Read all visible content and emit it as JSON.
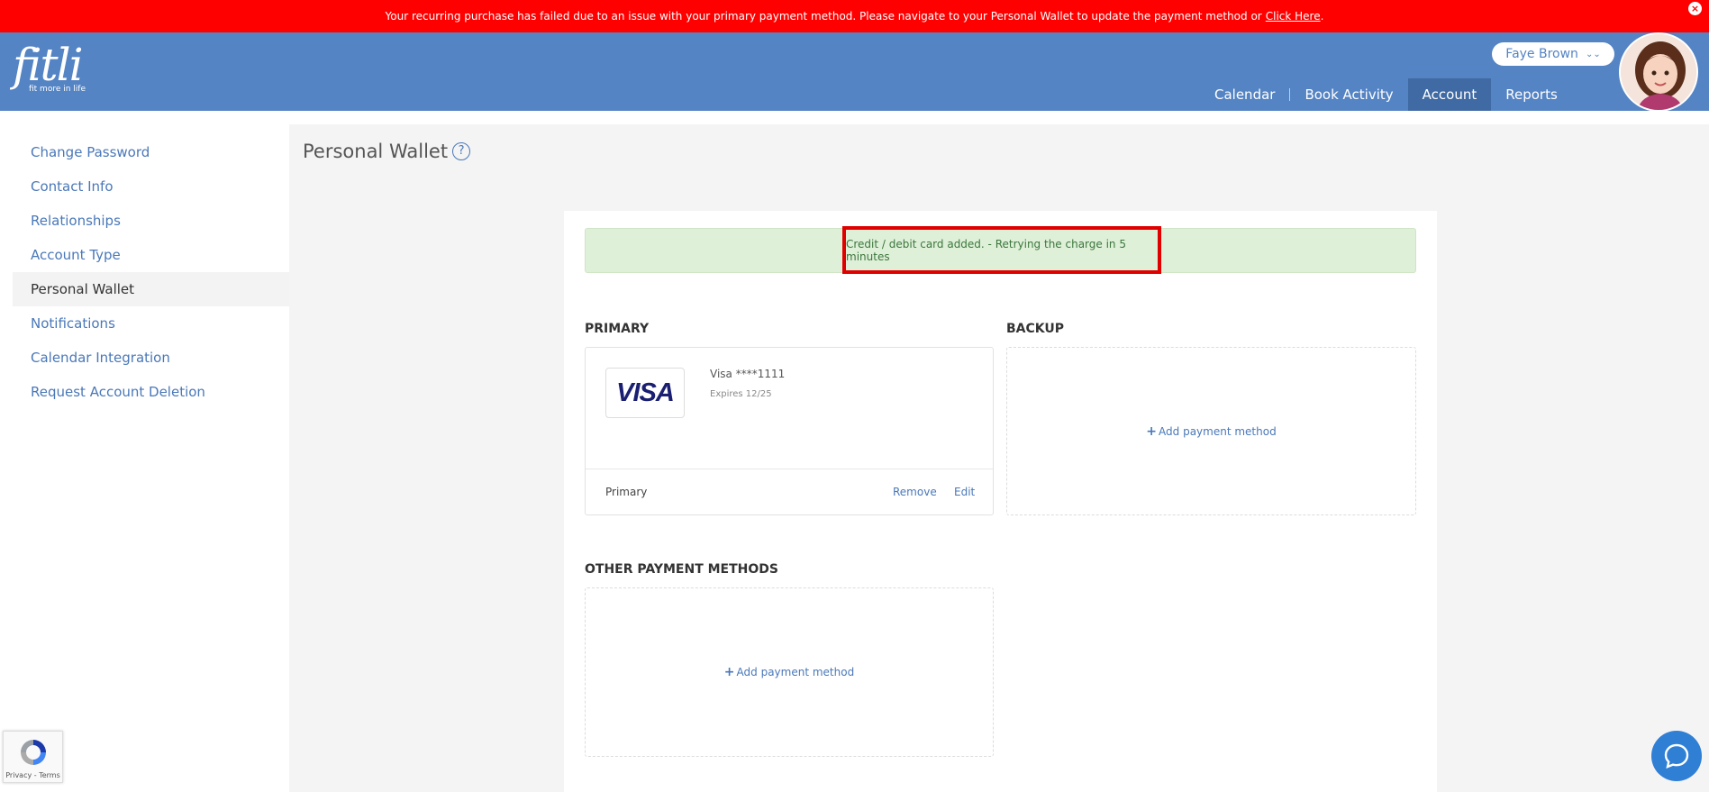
{
  "alert": {
    "message": "Your recurring purchase has failed due to an issue with your primary payment method. Please navigate to your Personal Wallet to update the payment method or",
    "link": "Click Here",
    "period": "."
  },
  "brand": {
    "name": "fitli",
    "tagline": "fit more in life"
  },
  "user": {
    "name": "Faye Brown"
  },
  "nav": {
    "items": [
      {
        "label": "Calendar"
      },
      {
        "label": "Book Activity"
      },
      {
        "label": "Account"
      },
      {
        "label": "Reports"
      }
    ],
    "active": "Account"
  },
  "sidebar": {
    "items": [
      {
        "label": "Change Password"
      },
      {
        "label": "Contact Info"
      },
      {
        "label": "Relationships"
      },
      {
        "label": "Account Type"
      },
      {
        "label": "Personal Wallet"
      },
      {
        "label": "Notifications"
      },
      {
        "label": "Calendar Integration"
      },
      {
        "label": "Request Account Deletion"
      }
    ],
    "active": "Personal Wallet"
  },
  "page": {
    "title": "Personal Wallet",
    "help_icon": "?"
  },
  "success_message": "Credit / debit card added. - Retrying the charge in 5 minutes",
  "primary": {
    "title": "PRIMARY",
    "card_brand": "VISA",
    "card_number": "Visa ****1111",
    "expires": "Expires 12/25",
    "footer_label": "Primary",
    "remove": "Remove",
    "edit": "Edit"
  },
  "backup": {
    "title": "BACKUP",
    "add": "Add payment method"
  },
  "other": {
    "title": "OTHER PAYMENT METHODS",
    "add": "Add payment method"
  },
  "recaptcha": {
    "text": "Privacy - Terms"
  },
  "colors": {
    "alert": "#ff0000",
    "header": "#5484c4",
    "active_nav": "#3f6aa3",
    "success_bg": "#def0d8",
    "link": "#4a78b8"
  }
}
